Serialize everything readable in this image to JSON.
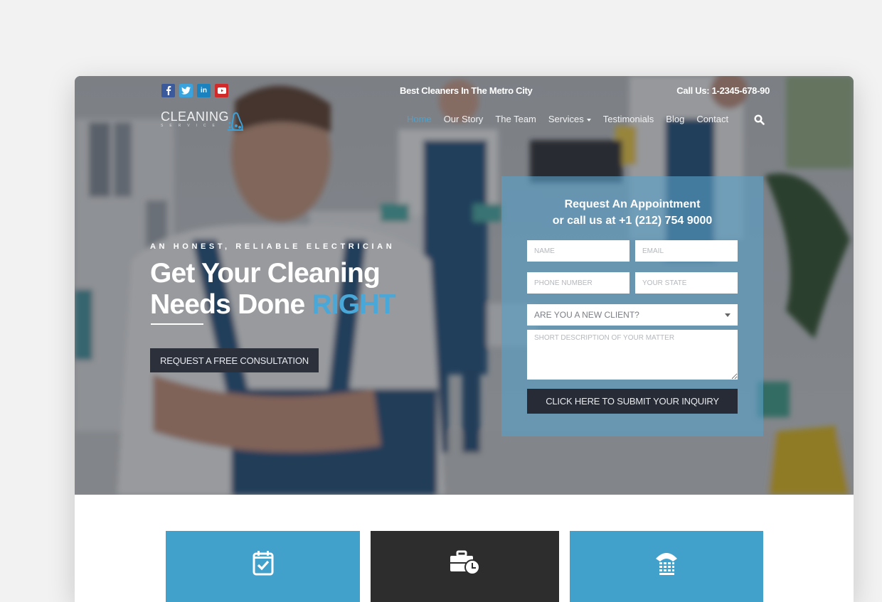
{
  "topbar": {
    "socials": [
      {
        "name": "facebook",
        "glyph": "f",
        "color": "#3b5a9b"
      },
      {
        "name": "twitter",
        "glyph": "t",
        "color": "#3aa3dd"
      },
      {
        "name": "linkedin",
        "glyph": "in",
        "color": "#1b82c0"
      },
      {
        "name": "youtube",
        "glyph": "▶",
        "color": "#d12a2a"
      }
    ],
    "tagline": "Best Cleaners In The Metro City",
    "call": "Call Us: 1-2345-678-90"
  },
  "logo": {
    "title": "CLEANING",
    "subtitle": "SERVICE"
  },
  "nav": {
    "items": [
      {
        "label": "Home",
        "active": true
      },
      {
        "label": "Our Story"
      },
      {
        "label": "The Team"
      },
      {
        "label": "Services",
        "has_dropdown": true
      },
      {
        "label": "Testimonials"
      },
      {
        "label": "Blog"
      },
      {
        "label": "Contact"
      }
    ]
  },
  "hero": {
    "eyebrow": "AN HONEST, RELIABLE ELECTRICIAN",
    "headline_line1": "Get Your Cleaning",
    "headline_line2": "Needs Done ",
    "headline_accent": "RIGHT",
    "cta_label": "REQUEST A FREE CONSULTATION"
  },
  "form": {
    "title_line1": "Request An Appointment",
    "title_line2": "or call us at +1 (212) 754 9000",
    "name_placeholder": "NAME",
    "email_placeholder": "EMAIL",
    "phone_placeholder": "PHONE NUMBER",
    "state_placeholder": "YOUR STATE",
    "client_select": "ARE YOU A NEW CLIENT?",
    "description_placeholder": "SHORT DESCRIPTION OF YOUR MATTER",
    "submit_label": "CLICK HERE TO SUBMIT YOUR INQUIRY"
  },
  "features": [
    {
      "icon": "calendar-check-icon",
      "color": "#42a1cb"
    },
    {
      "icon": "briefcase-clock-icon",
      "color": "#2d2d2d"
    },
    {
      "icon": "phone-keypad-icon",
      "color": "#42a1cb"
    }
  ],
  "colors": {
    "accent": "#4aa8d8",
    "dark": "#2b303b",
    "panel": "#58a0c8"
  }
}
